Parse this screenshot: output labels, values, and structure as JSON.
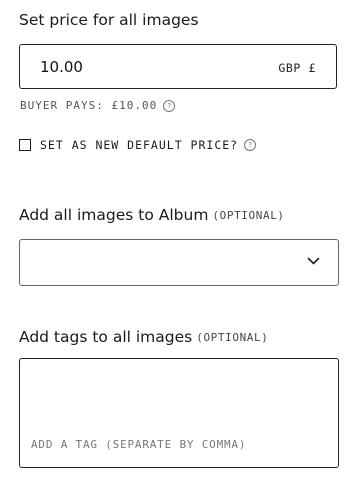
{
  "price_section": {
    "title": "Set price for all images",
    "value": "10.00",
    "currency": "GBP £",
    "buyer_pays": "BUYER PAYS: £10.00",
    "help_glyph": "?"
  },
  "default_price": {
    "label": "SET AS NEW DEFAULT PRICE?",
    "checked": false,
    "help_glyph": "?"
  },
  "album_section": {
    "title": "Add all images to Album",
    "optional": "(OPTIONAL)",
    "selected_value": ""
  },
  "tags_section": {
    "title": "Add tags to all images",
    "optional": "(OPTIONAL)",
    "placeholder": "ADD A TAG (SEPARATE BY COMMA)"
  },
  "icons": {
    "help": "question-circle-icon",
    "dropdown": "chevron-down-icon"
  }
}
